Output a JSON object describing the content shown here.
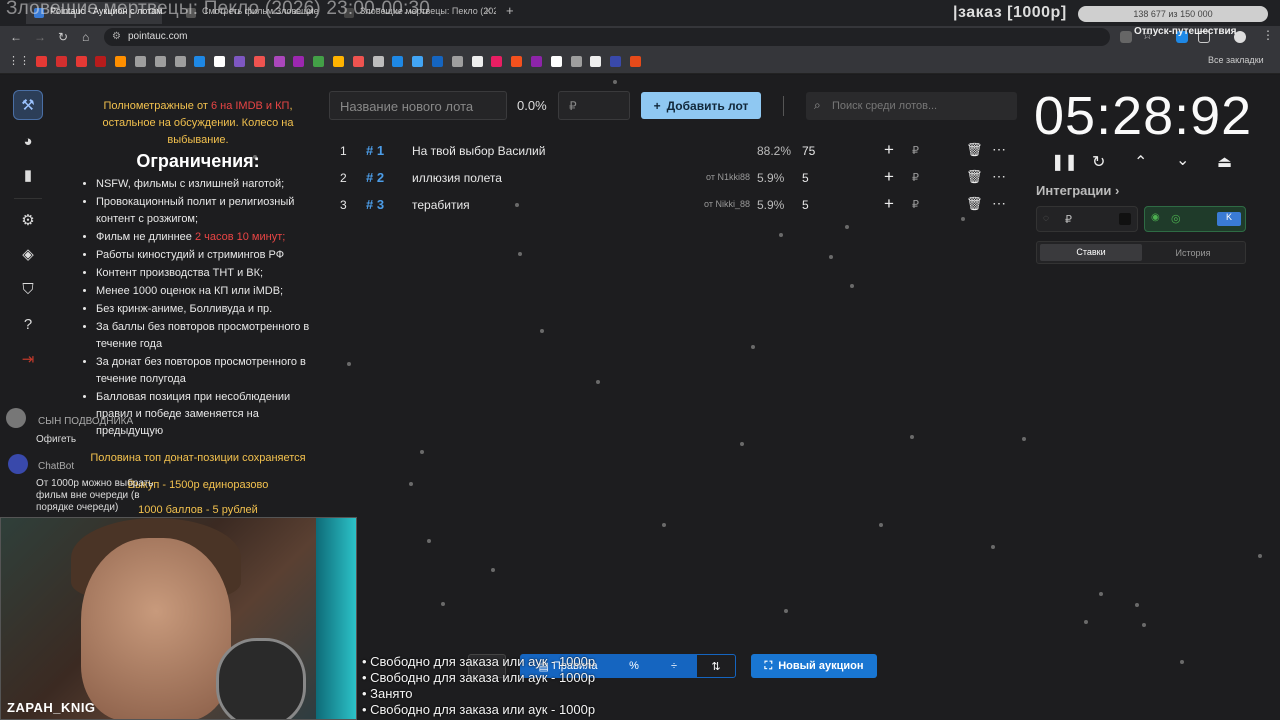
{
  "stream": {
    "title": "Зловещие мертвецы: Пекло (2026) 23:00-00:30",
    "order_overlay": "|заказ [1000р]",
    "progress": "138 677 из 150 000",
    "vacation": "Отпуск-путешествия",
    "streamer_nick": "ZAPAH_KNIG"
  },
  "browser": {
    "tabs": [
      {
        "label": "Pointauc - Аукцион с лотами"
      },
      {
        "label": "Смотреть фильм Зловещие..."
      },
      {
        "label": "Зловещие мертвецы: Пекло (2026)"
      }
    ],
    "url": "pointauc.com",
    "all_bookmarks": "Все закладки",
    "bookmark_colors": [
      "#e53935",
      "#d32f2f",
      "#e53935",
      "#b71c1c",
      "#ff8f00",
      "#9e9e9e",
      "#9e9e9e",
      "#9e9e9e",
      "#1e88e5",
      "#ffffff",
      "#7e57c2",
      "#ef5350",
      "#ab47bc",
      "#9c27b0",
      "#43a047",
      "#ffb300",
      "#ef5350",
      "#bdbdbd",
      "#1e88e5",
      "#42a5f5",
      "#1565c0",
      "#9e9e9e",
      "#eeeeee",
      "#e91e63",
      "#f4511e",
      "#8e24aa",
      "#ffffff",
      "#9e9e9e",
      "#eeeeee",
      "#3949ab",
      "#e64a19"
    ]
  },
  "rules": {
    "intro_before": "Полнометражные от",
    "intro_red": "6 на IMDB и КП",
    "intro_after": ", остальное на обсуждении. Колесо на выбывание.",
    "heading": "Ограничения:",
    "items": [
      {
        "text": "NSFW, фильмы с излишней наготой;"
      },
      {
        "text": "Провокационный полит и религиозный контент с розжигом;"
      },
      {
        "text": "Фильм не длиннее",
        "red": "2 часов 10 минут;"
      },
      {
        "text": "Работы киностудий и стримингов РФ"
      },
      {
        "text": "Контент производства ТНТ и ВК;"
      },
      {
        "text": "Менее 1000 оценок на КП или iMDB;"
      },
      {
        "text": "Без кринж-аниме, Болливуда и пр."
      },
      {
        "text": "За баллы без повторов просмотренного в течение года"
      },
      {
        "text": "За донат без повторов просмотренного в течение полугода"
      },
      {
        "text": "Балловая позиция при несоблюдении правил и победе заменяется на предыдущую"
      }
    ],
    "footer1": "Половина топ донат-позиции сохраняется",
    "footer2": "Выкуп - 1500р единоразово",
    "footer3": "1000 баллов - 5 рублей"
  },
  "chat": {
    "msg1_name": "СЫН ПОДВОДНИКА",
    "msg1_text": "Офигеть",
    "msg2_name": "ChatBot",
    "msg2_text": "От 1000р можно выбрать фильм вне очереди (в порядке очереди)"
  },
  "lot_form": {
    "name_placeholder": "Название нового лота",
    "percent": "0.0%",
    "amount_placeholder": "₽",
    "add_button": "Добавить лот",
    "search_placeholder": "Поиск среди лотов..."
  },
  "lots": [
    {
      "num": "1",
      "id": "# 1",
      "name": "На твой выбор Василий",
      "from": "",
      "pct": "88.2%",
      "value": "75"
    },
    {
      "num": "2",
      "id": "# 2",
      "name": "иллюзия полета",
      "from": "от N1kki88",
      "pct": "5.9%",
      "value": "5"
    },
    {
      "num": "3",
      "id": "# 3",
      "name": "терабития",
      "from": "от Nikki_88",
      "pct": "5.9%",
      "value": "5"
    }
  ],
  "timer": {
    "value": "05:28:92",
    "integrations_label": "Интеграции",
    "tab_bids": "Ставки",
    "tab_history": "История"
  },
  "bottom": {
    "rules_button": "Правила",
    "new_auction": "Новый аукцион"
  },
  "overlay_list": [
    "• Свободно для заказа или аук - 1000р",
    "• Свободно для заказа или аук - 1000р",
    "• Занято",
    "• Свободно для заказа или аук - 1000р"
  ]
}
